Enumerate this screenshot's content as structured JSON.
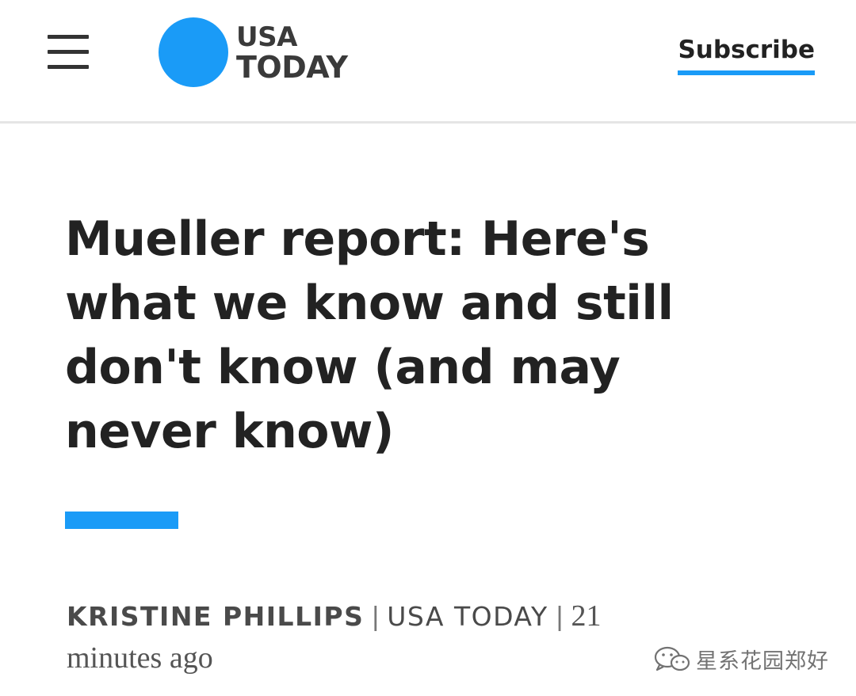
{
  "colors": {
    "brand_blue": "#1a9bf7",
    "headline": "#222222",
    "byline": "#4a4a4a"
  },
  "header": {
    "menu_icon": "hamburger-menu-icon",
    "logo": {
      "line1": "USA",
      "line2": "TODAY"
    },
    "subscribe_label": "Subscribe"
  },
  "article": {
    "headline": "Mueller report: Here's what we know and still don't know (and may never know)",
    "byline": {
      "author": "KRISTINE PHILLIPS",
      "separator": "|",
      "source": "USA TODAY",
      "time": "21 minutes ago"
    }
  },
  "watermark": {
    "icon": "wechat-official-account-icon",
    "text": "星系花园郑好"
  }
}
